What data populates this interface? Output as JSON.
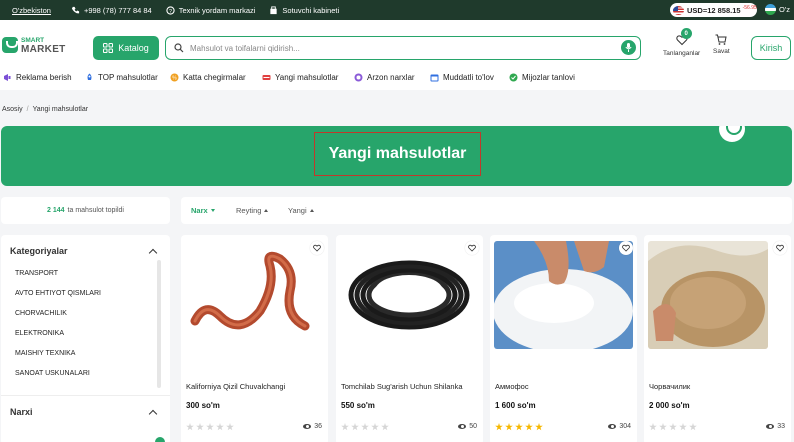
{
  "topbar": {
    "region": "O'zbekiston",
    "phone": "+998 (78) 777 84 84",
    "support": "Texnik yordam markazi",
    "seller": "Sotuvchi kabineti",
    "currency": "USD=12 858.15",
    "currency_delta": "-56.95",
    "language": "O'z"
  },
  "header": {
    "logo_line1": "SMART",
    "logo_line2": "MARKET",
    "catalog_label": "Katalog",
    "search_placeholder": "Mahsulot va toifalarni qidirish...",
    "favorites_label": "Tanlanganlar",
    "favorites_count": "0",
    "cart_label": "Savat",
    "login_label": "Kirish"
  },
  "nav": {
    "items": [
      {
        "label": "Reklama berish",
        "color": "#7b4fd6"
      },
      {
        "label": "TOP mahsulotlar",
        "color": "#2f6fe0"
      },
      {
        "label": "Katta chegirmalar",
        "color": "#f0a020"
      },
      {
        "label": "Yangi mahsulotlar",
        "color": "#e04040"
      },
      {
        "label": "Arzon narxlar",
        "color": "#8a5ad8"
      },
      {
        "label": "Muddatli to'lov",
        "color": "#2f6fe0"
      },
      {
        "label": "Mijozlar tanlovi",
        "color": "#2fa84f"
      }
    ]
  },
  "breadcrumb": {
    "home": "Asosiy",
    "separator": "/",
    "current": "Yangi mahsulotlar"
  },
  "banner": {
    "title": "Yangi mahsulotlar"
  },
  "results": {
    "count": "2 144",
    "label": "ta mahsulot topildi"
  },
  "sort": {
    "price": "Narx",
    "rating": "Reyting",
    "new": "Yangi"
  },
  "sidebar": {
    "categories_title": "Kategoriyalar",
    "categories": [
      "TRANSPORT",
      "AVTO EHTIYOT QISMLARI",
      "CHORVACHILIK",
      "ELEKTRONIKA",
      "MAISHIY TEXNIKA",
      "SANOAT USKUNALARI"
    ],
    "price_title": "Narxi"
  },
  "products": [
    {
      "title": "Kaliforniya Qizil Chuvalchangi",
      "price": "300 so'm",
      "rating": 0,
      "views": "36"
    },
    {
      "title": "Tomchilab Sug'arish Uchun Shilanka",
      "price": "550 so'm",
      "rating": 0,
      "views": "50"
    },
    {
      "title": "Аммофос",
      "price": "1 600 so'm",
      "rating": 5,
      "views": "304"
    },
    {
      "title": "Чорвачилик",
      "price": "2 000 so'm",
      "rating": 0,
      "views": "33"
    }
  ],
  "colors": {
    "brand_green": "#27a56b",
    "topbar_bg": "#1f3a2c",
    "star_on": "#f6b700",
    "highlight_box": "#c0392b"
  }
}
